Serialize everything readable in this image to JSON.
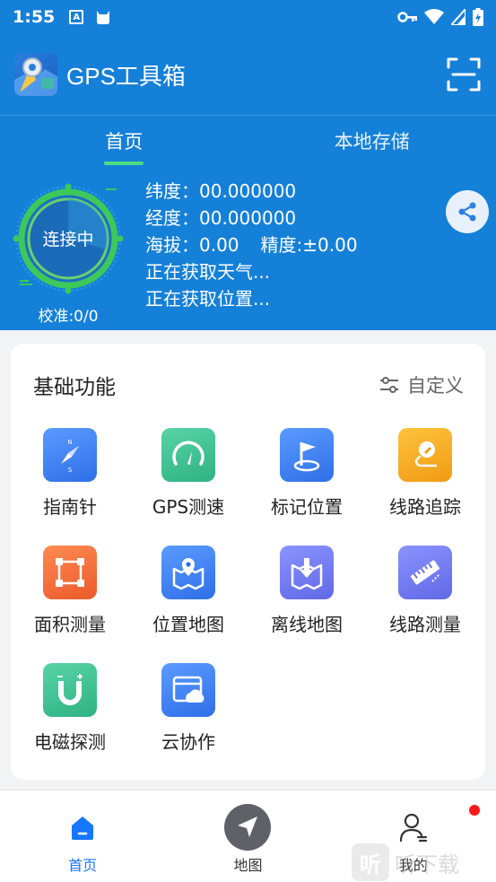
{
  "status_bar": {
    "time": "1:55",
    "a_icon_letter": "A"
  },
  "app": {
    "title": "GPS工具箱"
  },
  "tabs": [
    {
      "label": "首页",
      "active": true
    },
    {
      "label": "本地存储",
      "active": false
    }
  ],
  "gps": {
    "status": "连接中",
    "calibration": "校准:0/0",
    "latitude": "纬度：00.000000",
    "longitude": "经度：00.000000",
    "altitude": "海拔：0.00",
    "accuracy": "精度:±0.00",
    "weather_status": "正在获取天气...",
    "location_status": "正在获取位置..."
  },
  "basic_functions": {
    "title": "基础功能",
    "customize_label": "自定义",
    "items": [
      {
        "label": "指南针",
        "icon": "compass-icon",
        "color": "#3b7ff5"
      },
      {
        "label": "GPS测速",
        "icon": "speedometer-icon",
        "color": "#3cc396"
      },
      {
        "label": "标记位置",
        "icon": "flag-icon",
        "color": "#3b7ff5"
      },
      {
        "label": "线路追踪",
        "icon": "route-pen-icon",
        "color": "#f5a623"
      },
      {
        "label": "面积测量",
        "icon": "area-icon",
        "color": "#f0673a"
      },
      {
        "label": "位置地图",
        "icon": "map-pin-icon",
        "color": "#3b7ff5"
      },
      {
        "label": "离线地图",
        "icon": "offline-map-icon",
        "color": "#6f79f0"
      },
      {
        "label": "线路测量",
        "icon": "ruler-icon",
        "color": "#6f79f0"
      },
      {
        "label": "电磁探测",
        "icon": "magnet-icon",
        "color": "#3cc396"
      },
      {
        "label": "云协作",
        "icon": "cloud-icon",
        "color": "#3b7ff5"
      }
    ]
  },
  "bottom_nav": [
    {
      "label": "首页",
      "icon": "home-icon",
      "active": true
    },
    {
      "label": "地图",
      "icon": "navigation-arrow-icon",
      "active": false
    },
    {
      "label": "我的",
      "icon": "user-icon",
      "active": false
    }
  ],
  "watermark": {
    "text": "听下载",
    "glyph": "听"
  },
  "colors": {
    "brand_blue": "#1580d8",
    "accent_green": "#4ade80",
    "active_nav": "#1677ff",
    "notification": "#ff1a1a"
  }
}
